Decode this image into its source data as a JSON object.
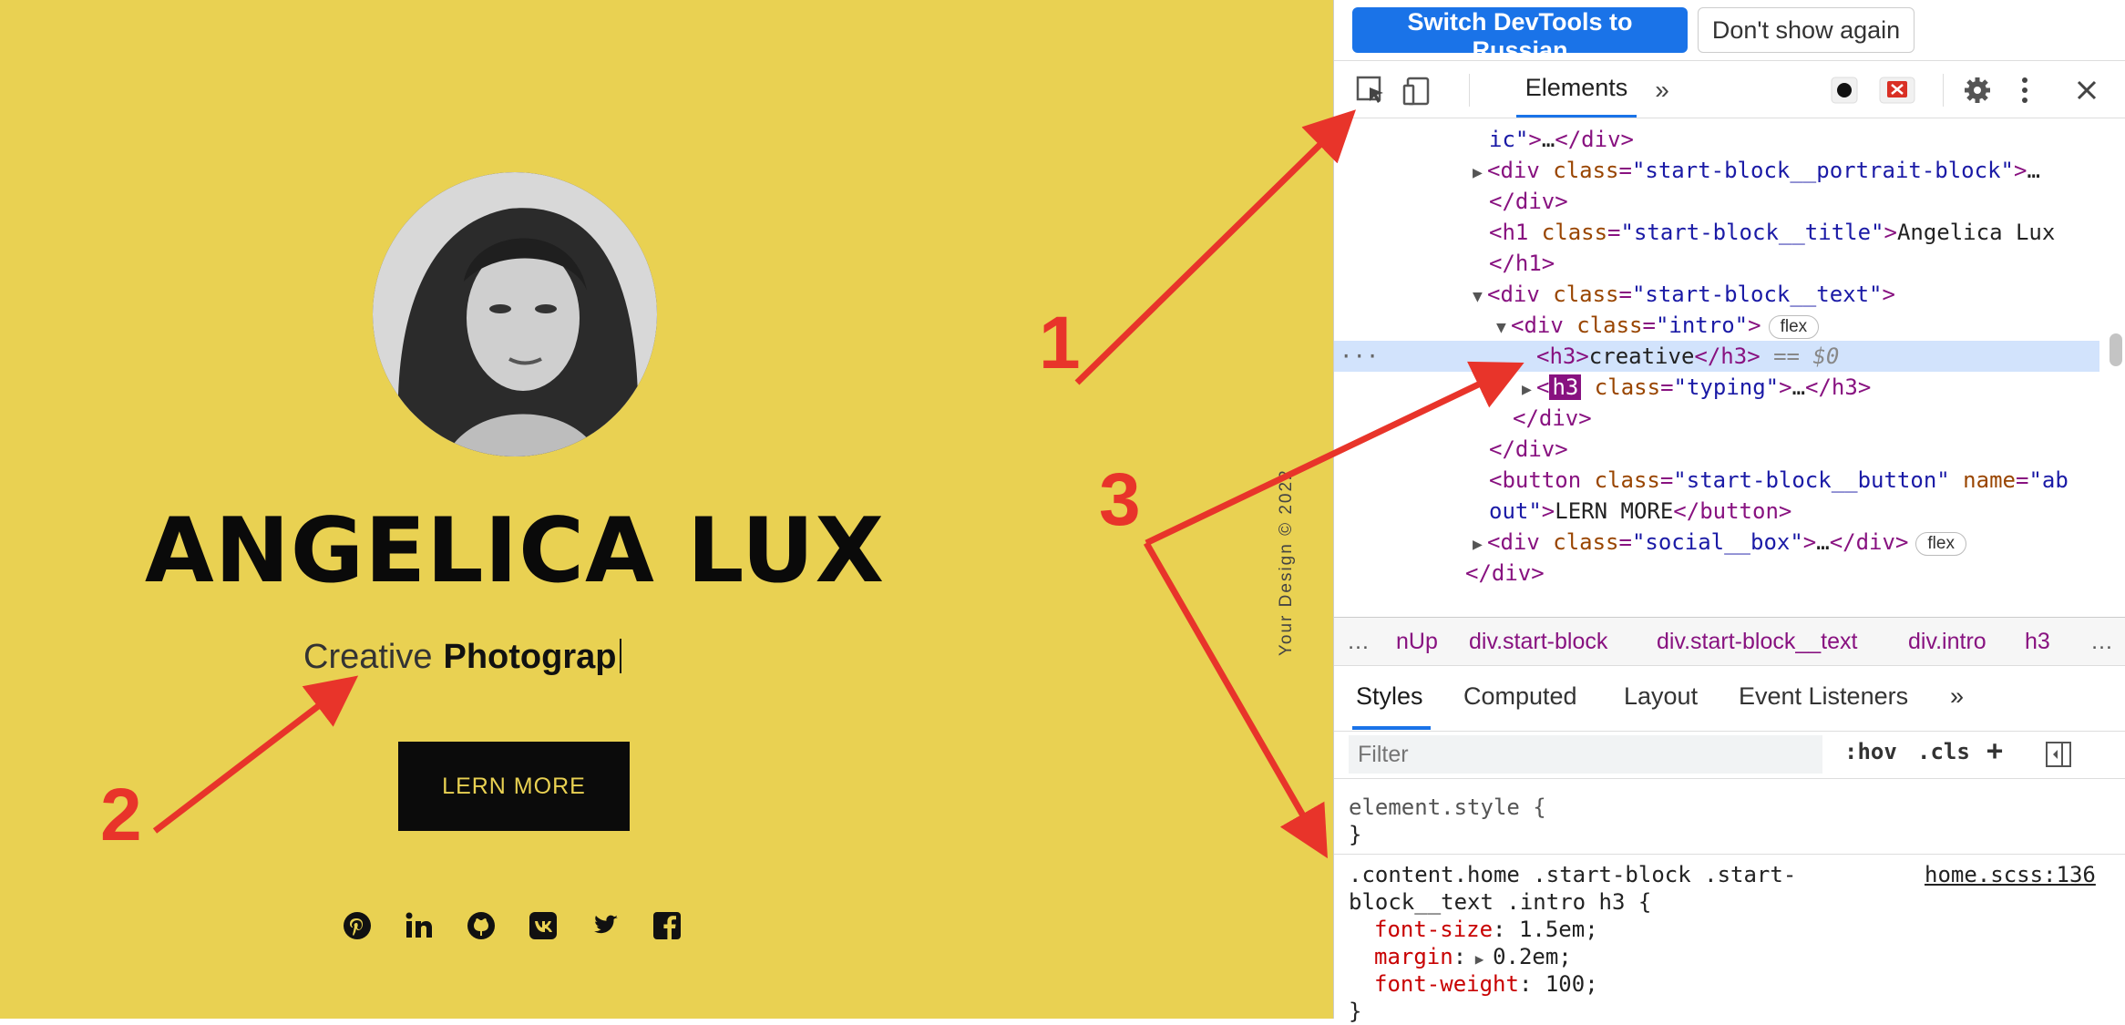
{
  "site": {
    "title": "ANGELICA LUX",
    "subtitle_light": "Creative",
    "subtitle_bold": "Photograp",
    "button_label": "LERN MORE",
    "footer_vertical": "Your Design © 2022",
    "social_icons": [
      "pinterest-icon",
      "linkedin-icon",
      "github-icon",
      "vk-icon",
      "twitter-icon",
      "facebook-icon"
    ],
    "social_glyphs": [
      "℗",
      "in",
      "",
      "vk",
      "",
      "f"
    ]
  },
  "annotations": {
    "a1": "1",
    "a2": "2",
    "a3": "3",
    "color": "#e8342a"
  },
  "devtools": {
    "infobar": {
      "switch_label": "Switch DevTools to Russian",
      "dont_show_label": "Don't show again"
    },
    "toolbar": {
      "elements_tab": "Elements",
      "more_tabs": "»"
    },
    "dom": [
      {
        "t": "ic\">…</div>"
      },
      {
        "t": "<div class=\"start-block__portrait-block\">…"
      },
      {
        "t": "</div>"
      },
      {
        "t": "<h1 class=\"start-block__title\">Angelica Lux"
      },
      {
        "t": "</h1>"
      },
      {
        "t": "<div class=\"start-block__text\">"
      },
      {
        "t": "<div class=\"intro\">",
        "badge": "flex"
      },
      {
        "t": "<h3>creative</h3>",
        "eq": "== $0"
      },
      {
        "t": "class=\"typing\">…</h3>",
        "tagbox": "h3"
      },
      {
        "t": "</div>"
      },
      {
        "t": "</div>"
      },
      {
        "t": "<button class=\"start-block__button\" name=\"ab"
      },
      {
        "t": "out\">LERN MORE</button>"
      },
      {
        "t": "<div class=\"social__box\">…</div>",
        "badge": "flex"
      },
      {
        "t": "</div>"
      }
    ],
    "breadcrumbs": [
      "…",
      "nUp",
      "div.start-block",
      "div.start-block__text",
      "div.intro",
      "h3",
      "…"
    ],
    "sub_tabs": [
      "Styles",
      "Computed",
      "Layout",
      "Event Listeners",
      "»"
    ],
    "filter_placeholder": "Filter",
    "filter_buttons": [
      ":hov",
      ".cls",
      "+"
    ],
    "styles": {
      "element_style_open": "element.style {",
      "element_style_close": "}",
      "rule_selector_1": ".content.home .start-block .start-",
      "rule_selector_2": "block__text .intro h3 {",
      "source": "home.scss:136",
      "props": [
        {
          "name": "font-size",
          "value": "1.5em;"
        },
        {
          "name": "margin",
          "value": "0.2em;"
        },
        {
          "name": "font-weight",
          "value": "100;"
        }
      ],
      "close": "}"
    }
  }
}
